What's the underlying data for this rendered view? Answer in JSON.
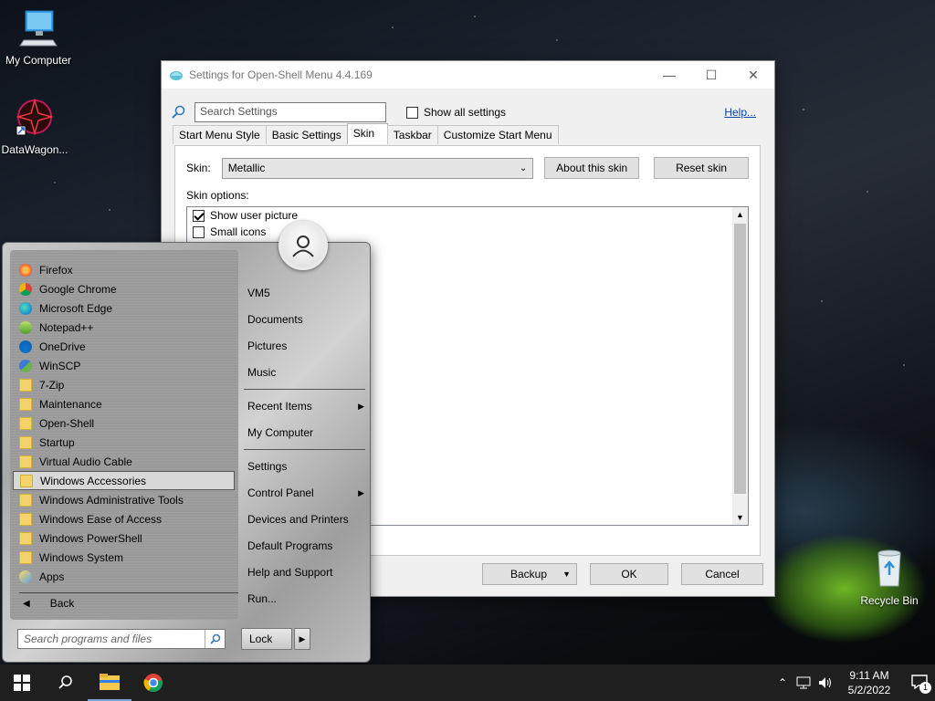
{
  "desktop": {
    "icons": [
      {
        "label": "My Computer"
      },
      {
        "label": "DataWagon..."
      },
      {
        "label": "Recycle Bin"
      }
    ]
  },
  "window": {
    "title": "Settings for Open-Shell Menu 4.4.169",
    "search_placeholder": "Search Settings",
    "show_all_label": "Show all settings",
    "help_label": "Help...",
    "tabs": [
      {
        "label": "Start Menu Style"
      },
      {
        "label": "Basic Settings"
      },
      {
        "label": "Skin"
      },
      {
        "label": "Taskbar"
      },
      {
        "label": "Customize Start Menu"
      }
    ],
    "skin_label": "Skin:",
    "skin_value": "Metallic",
    "about_skin_label": "About this skin",
    "reset_skin_label": "Reset skin",
    "skin_options_label": "Skin options:",
    "options": [
      {
        "label": "Show user picture",
        "checked": true
      },
      {
        "label": "Small icons",
        "checked": false
      }
    ],
    "backup_label": "Backup",
    "ok_label": "OK",
    "cancel_label": "Cancel"
  },
  "start_menu": {
    "programs": [
      {
        "label": "Firefox",
        "icon": "firefox-icon"
      },
      {
        "label": "Google Chrome",
        "icon": "chrome-icon"
      },
      {
        "label": "Microsoft Edge",
        "icon": "edge-icon"
      },
      {
        "label": "Notepad++",
        "icon": "notepadpp-icon"
      },
      {
        "label": "OneDrive",
        "icon": "onedrive-icon"
      },
      {
        "label": "WinSCP",
        "icon": "winscp-icon"
      },
      {
        "label": "7-Zip",
        "icon": "folder-icon"
      },
      {
        "label": "Maintenance",
        "icon": "folder-icon"
      },
      {
        "label": "Open-Shell",
        "icon": "folder-icon"
      },
      {
        "label": "Startup",
        "icon": "folder-icon"
      },
      {
        "label": "Virtual Audio Cable",
        "icon": "folder-icon"
      },
      {
        "label": "Windows Accessories",
        "icon": "folder-icon",
        "selected": true
      },
      {
        "label": "Windows Administrative Tools",
        "icon": "folder-icon"
      },
      {
        "label": "Windows Ease of Access",
        "icon": "folder-icon"
      },
      {
        "label": "Windows PowerShell",
        "icon": "folder-icon"
      },
      {
        "label": "Windows System",
        "icon": "folder-icon"
      },
      {
        "label": "Apps",
        "icon": "apps-icon"
      }
    ],
    "back_label": "Back",
    "right_items": [
      {
        "label": "VM5"
      },
      {
        "label": "Documents"
      },
      {
        "label": "Pictures"
      },
      {
        "label": "Music"
      },
      {
        "label": "Recent Items"
      },
      {
        "label": "My Computer"
      },
      {
        "label": "Settings"
      },
      {
        "label": "Control Panel"
      },
      {
        "label": "Devices and Printers"
      },
      {
        "label": "Default Programs"
      },
      {
        "label": "Help and Support"
      },
      {
        "label": "Run..."
      }
    ],
    "search_placeholder": "Search programs and files",
    "lock_label": "Lock"
  },
  "taskbar": {
    "time": "9:11 AM",
    "date": "5/2/2022",
    "notification_count": "1"
  }
}
